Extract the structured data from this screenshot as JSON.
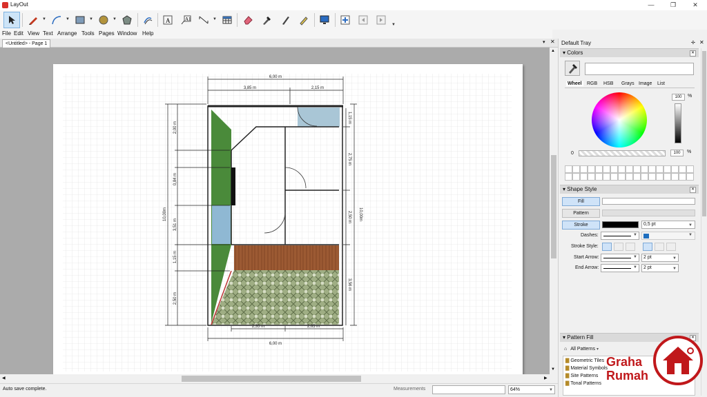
{
  "window": {
    "title": "LayOut",
    "min": "—",
    "max": "❐",
    "close": "✕"
  },
  "menu": [
    "File",
    "Edit",
    "View",
    "Text",
    "Arrange",
    "Tools",
    "Pages",
    "Window",
    "Help"
  ],
  "doc_tab": "<Untitled> - Page 1",
  "drawing": {
    "dims": {
      "top_total": "6,00 m",
      "top_left": "3,85 m",
      "top_right": "2,15 m",
      "bottom_left": "2,35 m",
      "bottom_right": "2,65 m",
      "bottom_total": "6,00 m",
      "left_total": "10,00m",
      "right_total": "10,00m",
      "left_1": "2,00 m",
      "left_2": "0,84 m",
      "left_3": "3,51 m",
      "left_4": "1,15 m",
      "left_5": "2,50 m",
      "right_1": "1,15 m",
      "right_2": "2,75 m",
      "right_3": "2,50 m",
      "right_4": "3,56 m"
    }
  },
  "status": {
    "message": "Auto save complete.",
    "measurements_label": "Measurements",
    "zoom": "64%"
  },
  "tray": {
    "title": "Default Tray",
    "colors": {
      "title": "Colors",
      "tabs": [
        "Wheel",
        "RGB",
        "HSB",
        "Grays",
        "Image",
        "List"
      ],
      "brightness": "100",
      "percent": "%",
      "opacity_min": "0",
      "opacity": "100",
      "opacity_percent": "%"
    },
    "shape_style": {
      "title": "Shape Style",
      "fill": "Fill",
      "pattern": "Pattern",
      "stroke": "Stroke",
      "stroke_width": "0,5 pt",
      "dashes": "Dashes:",
      "stroke_style": "Stroke Style:",
      "start_arrow": "Start Arrow:",
      "start_arrow_size": "2 pt",
      "end_arrow": "End Arrow:",
      "end_arrow_size": "2 pt",
      "stroke_color": "#000000",
      "dash_color": "#1f6fbf"
    },
    "pattern_fill": {
      "title": "Pattern Fill",
      "source": "All Patterns",
      "folders": [
        "Geometric Tiles",
        "Material Symbols",
        "Site Patterns",
        "Tonal Patterns"
      ]
    }
  },
  "watermark": {
    "line1": "Graha",
    "line2": "Rumah",
    "color": "#c0181b"
  }
}
